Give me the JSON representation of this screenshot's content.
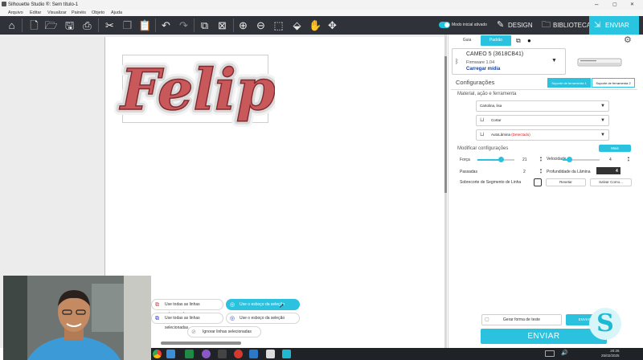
{
  "window": {
    "title": "Silhouette Studio ®: Sem título-1",
    "controls": {
      "minimize": "–",
      "maximize": "▢",
      "close": "✕"
    }
  },
  "menubar": [
    "Arquivo",
    "Editar",
    "Visualizar",
    "Painéis",
    "Objeto",
    "Ajuda"
  ],
  "toolbar": {
    "toggle_label": "Modo inicial ativado",
    "tabs": {
      "design": "DESIGN",
      "library": "BIBLIOTECA",
      "send": "ENVIAR"
    }
  },
  "canvas": {
    "design_text": "Felipe"
  },
  "panel": {
    "tabs": {
      "guide": "Guia",
      "standard": "Padrão"
    },
    "device": {
      "name": "CAMEO 5 (3618CB41)",
      "firmware": "Firmware 1.04",
      "load_media": "Carregar mídia"
    },
    "settings_title": "Configurações",
    "tool_tabs": [
      "Suporte de ferramenta 1",
      "Suporte de ferramenta 2"
    ],
    "material_section": "Material, ação e ferramenta",
    "material": "Cartolina, lisa",
    "action": "Cortar",
    "tool": "AutoLâmina",
    "tool_detected": "(Detectado)",
    "modify_title": "Modificar configurações",
    "more_button": "Mais",
    "params": {
      "force_label": "Força",
      "force_value": "21",
      "speed_label": "Velocidade",
      "speed_value": "4",
      "passes_label": "Passadas",
      "passes_value": "2",
      "depth_label": "Profundidade da Lâmina",
      "depth_value": "4",
      "overcut_label": "Sobrecorte de Segmento de Linha"
    },
    "reset_button": "Resetar",
    "save_as_button": "Salvar Como...",
    "test_button": "Gerar forma de teste",
    "send_small_label": "ENVIAR",
    "send_button": "ENVIAR"
  },
  "line_options": [
    "Use todas as linhas selecionadas",
    "Use o esboço da seleção",
    "Use todas as linhas selecionadas",
    "Use o esboço da seleção",
    "Ignorar linhas selecionadas"
  ],
  "taskbar": {
    "time": "20:25",
    "date": "25/02/2025"
  },
  "colors": {
    "accent": "#2bc2df",
    "toolbar": "#2f3238",
    "felipe_fill": "#c9585b",
    "felipe_stroke": "#8e2f33"
  }
}
